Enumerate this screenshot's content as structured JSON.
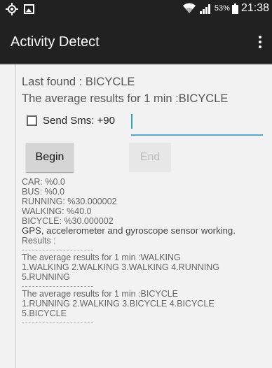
{
  "status_bar": {
    "battery_percent": "53%",
    "time": "21:38",
    "icons": [
      "gps-icon",
      "image-icon",
      "wifi-icon",
      "signal-icon",
      "battery-icon"
    ]
  },
  "app_bar": {
    "title": "Activity Detect",
    "menu_icon": "overflow-menu-icon"
  },
  "main": {
    "last_found": "Last found : BICYCLE",
    "average_line": "The average results for 1 min :BICYCLE",
    "sms_label": "Send Sms: +90",
    "sms_checked": false,
    "sms_value": "",
    "begin_label": "Begin",
    "end_label": "End",
    "stats": [
      "CAR: %0.0",
      "BUS: %0.0",
      "RUNNING: %30.000002",
      "WALKING: %40.0",
      "BICYCLE: %30.000002"
    ],
    "sensor_status": "GPS, accelerometer and gyroscope sensor working.",
    "results_label": "Results :",
    "results": [
      {
        "average": "The average results for 1 min :WALKING",
        "line1": "1.WALKING 2.WALKING 3.WALKING 4.RUNNING",
        "line2": "5.RUNNING"
      },
      {
        "average": "The average results for 1 min :BICYCLE",
        "line1": "1.RUNNING 2.WALKING 3.BICYCLE 4.BICYCLE",
        "line2": "5.BICYCLE"
      }
    ]
  },
  "colors": {
    "status_bar_bg": "#212121",
    "content_bg": "#f2f2f2",
    "accent": "#5aa9c8"
  }
}
